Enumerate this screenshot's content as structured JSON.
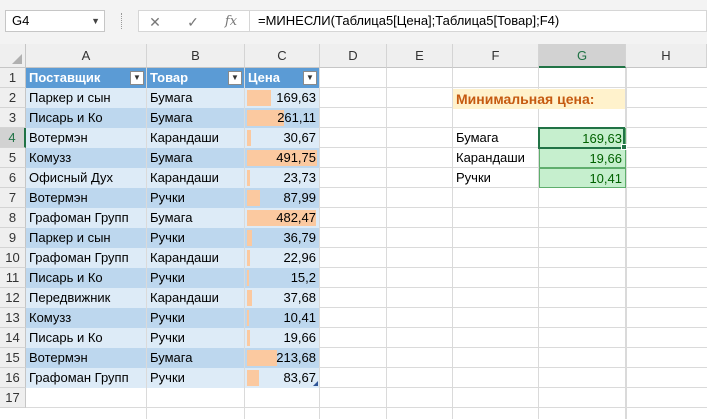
{
  "formula_bar": {
    "name_box": "G4",
    "cancel_symbol": "✕",
    "enter_symbol": "✓",
    "fx_symbol": "fx",
    "formula": "=МИНЕСЛИ(Таблица5[Цена];Таблица5[Товар];F4)"
  },
  "columns": [
    "A",
    "B",
    "C",
    "D",
    "E",
    "F",
    "G",
    "H"
  ],
  "rows": [
    "1",
    "2",
    "3",
    "4",
    "5",
    "6",
    "7",
    "8",
    "9",
    "10",
    "11",
    "12",
    "13",
    "14",
    "15",
    "16",
    "17"
  ],
  "table": {
    "headers": [
      "Поставщик",
      "Товар",
      "Цена"
    ],
    "rows": [
      {
        "supplier": "Паркер и сын",
        "product": "Бумага",
        "price": "169,63",
        "price_value": 169.63
      },
      {
        "supplier": "Писарь и Ко",
        "product": "Бумага",
        "price": "261,11",
        "price_value": 261.11
      },
      {
        "supplier": "Вотермэн",
        "product": "Карандаши",
        "price": "30,67",
        "price_value": 30.67
      },
      {
        "supplier": "Комузз",
        "product": "Бумага",
        "price": "491,75",
        "price_value": 491.75
      },
      {
        "supplier": "Офисный Дух",
        "product": "Карандаши",
        "price": "23,73",
        "price_value": 23.73
      },
      {
        "supplier": "Вотермэн",
        "product": "Ручки",
        "price": "87,99",
        "price_value": 87.99
      },
      {
        "supplier": "Графоман Групп",
        "product": "Бумага",
        "price": "482,47",
        "price_value": 482.47
      },
      {
        "supplier": "Паркер и сын",
        "product": "Ручки",
        "price": "36,79",
        "price_value": 36.79
      },
      {
        "supplier": "Графоман Групп",
        "product": "Карандаши",
        "price": "22,96",
        "price_value": 22.96
      },
      {
        "supplier": "Писарь и Ко",
        "product": "Ручки",
        "price": "15,2",
        "price_value": 15.2
      },
      {
        "supplier": "Передвижник",
        "product": "Карандаши",
        "price": "37,68",
        "price_value": 37.68
      },
      {
        "supplier": "Комузз",
        "product": "Ручки",
        "price": "10,41",
        "price_value": 10.41
      },
      {
        "supplier": "Писарь и Ко",
        "product": "Ручки",
        "price": "19,66",
        "price_value": 19.66
      },
      {
        "supplier": "Вотермэн",
        "product": "Бумага",
        "price": "213,68",
        "price_value": 213.68
      },
      {
        "supplier": "Графоман Групп",
        "product": "Ручки",
        "price": "83,67",
        "price_value": 83.67
      }
    ],
    "databar_max": 491.75,
    "databar_color": "#fbc9a0"
  },
  "summary": {
    "title": "Минимальная цена:",
    "items": [
      {
        "product": "Бумага",
        "min_price": "169,63"
      },
      {
        "product": "Карандаши",
        "min_price": "19,66"
      },
      {
        "product": "Ручки",
        "min_price": "10,41"
      }
    ]
  },
  "colors": {
    "excel_green": "#217346",
    "table_header": "#5b9bd5",
    "band_light": "#ddebf7",
    "band_dark": "#bdd7ee",
    "title_bg": "#fff2cc",
    "title_text": "#c55a11",
    "result_bg": "#c6efce",
    "result_text": "#006100"
  }
}
